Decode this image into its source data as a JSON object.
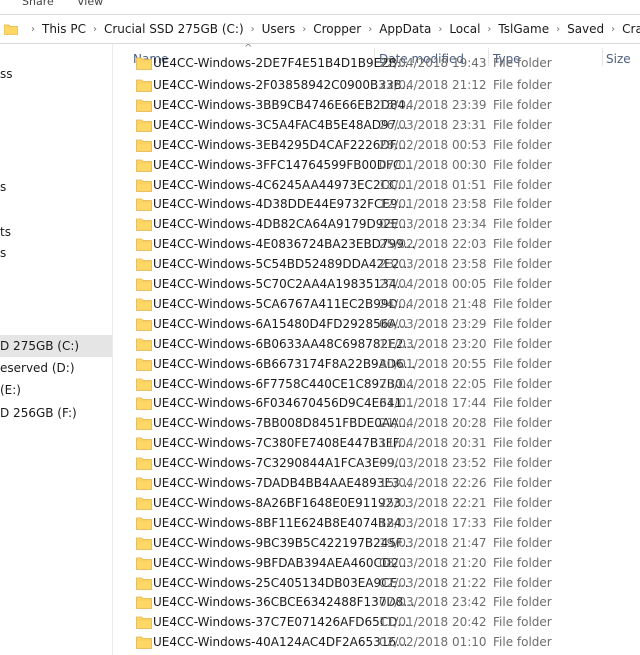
{
  "ribbon": {
    "tabs": [
      "Share",
      "View"
    ]
  },
  "address": {
    "crumbs": [
      "This PC",
      "Crucial SSD 275GB (C:)",
      "Users",
      "Cropper",
      "AppData",
      "Local",
      "TslGame",
      "Saved",
      "Crashes"
    ]
  },
  "nav": {
    "items": [
      {
        "label": "ss",
        "state": ""
      },
      {
        "label": "s",
        "state": ""
      },
      {
        "label": "ts",
        "state": ""
      },
      {
        "label": "s",
        "state": ""
      },
      {
        "label": "D 275GB (C:)",
        "state": "selected"
      },
      {
        "label": "eserved (D:)",
        "state": ""
      },
      {
        "label": "(E:)",
        "state": ""
      },
      {
        "label": "D 256GB (F:)",
        "state": ""
      }
    ]
  },
  "columns": {
    "name": "Name",
    "date": "Date modified",
    "type": "Type",
    "size": "Size"
  },
  "files": [
    {
      "name": "UE4CC-Windows-2F03858942C0900B33B...",
      "date": "22/04/2018 21:12",
      "type": "File folder"
    },
    {
      "name": "UE4CC-Windows-3BB9CB4746E66EB2D84...",
      "date": "15/04/2018 23:39",
      "type": "File folder"
    },
    {
      "name": "UE4CC-Windows-3C5A4FAC4B5E48AD97...",
      "date": "26/03/2018 23:31",
      "type": "File folder"
    },
    {
      "name": "UE4CC-Windows-3EB4295D4CAF2226DF...",
      "date": "28/02/2018 00:53",
      "type": "File folder"
    },
    {
      "name": "UE4CC-Windows-3FFC14764599FB00DFC...",
      "date": "07/01/2018 00:30",
      "type": "File folder"
    },
    {
      "name": "UE4CC-Windows-4C6245AA44973EC2CC...",
      "date": "18/01/2018 01:51",
      "type": "File folder"
    },
    {
      "name": "UE4CC-Windows-4D38DDE44E9732FCE9...",
      "date": "12/01/2018 23:58",
      "type": "File folder"
    },
    {
      "name": "UE4CC-Windows-4DB82CA64A9179D92E...",
      "date": "03/03/2018 23:34",
      "type": "File folder"
    },
    {
      "name": "UE4CC-Windows-4E0836724BA23EBD799...",
      "date": "25/02/2018 22:03",
      "type": "File folder"
    },
    {
      "name": "UE4CC-Windows-5C54BD52489DDA42E2...",
      "date": "23/03/2018 23:58",
      "type": "File folder"
    },
    {
      "name": "UE4CC-Windows-5C70C2AA4A19835134...",
      "date": "27/04/2018 00:05",
      "type": "File folder"
    },
    {
      "name": "UE4CC-Windows-5CA6767A411EC2B99D...",
      "date": "24/04/2018 21:48",
      "type": "File folder"
    },
    {
      "name": "UE4CC-Windows-6A15480D4FD292856A...",
      "date": "06/03/2018 23:29",
      "type": "File folder"
    },
    {
      "name": "UE4CC-Windows-6B0633AA48C698782E2...",
      "date": "11/03/2018 23:20",
      "type": "File folder"
    },
    {
      "name": "UE4CC-Windows-6B6673174F8A22B9AD6...",
      "date": "30/01/2018 20:55",
      "type": "File folder"
    },
    {
      "name": "UE4CC-Windows-6F7758C440CE1C897B0...",
      "date": "23/04/2018 22:05",
      "type": "File folder"
    },
    {
      "name": "UE4CC-Windows-6F034670456D9C4E641...",
      "date": "31/01/2018 17:44",
      "type": "File folder"
    },
    {
      "name": "UE4CC-Windows-7BB008D8451FBDE0AA...",
      "date": "21/04/2018 20:28",
      "type": "File folder"
    },
    {
      "name": "UE4CC-Windows-7C380FE7408E447B3FF...",
      "date": "11/04/2018 20:31",
      "type": "File folder"
    },
    {
      "name": "UE4CC-Windows-7C3290844A1FCA3E99...",
      "date": "09/03/2018 23:52",
      "type": "File folder"
    },
    {
      "name": "UE4CC-Windows-7DADB4BB4AAE4893E3...",
      "date": "15/04/2018 22:26",
      "type": "File folder"
    },
    {
      "name": "UE4CC-Windows-8A26BF1648E0E911923...",
      "date": "25/03/2018 22:21",
      "type": "File folder"
    },
    {
      "name": "UE4CC-Windows-8BF11E624B8E4074B24...",
      "date": "18/03/2018 17:33",
      "type": "File folder"
    },
    {
      "name": "UE4CC-Windows-9BC39B5C422197B245F...",
      "date": "19/03/2018 21:47",
      "type": "File folder"
    },
    {
      "name": "UE4CC-Windows-9BFDAB394AEA460CD2...",
      "date": "08/03/2018 21:20",
      "type": "File folder"
    },
    {
      "name": "UE4CC-Windows-25C405134DB03EA9CE...",
      "date": "02/03/2018 21:22",
      "type": "File folder"
    },
    {
      "name": "UE4CC-Windows-36CBCE6342488F137D8...",
      "date": "07/03/2018 23:42",
      "type": "File folder"
    },
    {
      "name": "UE4CC-Windows-37C7E071426AFD65CD...",
      "date": "11/01/2018 20:42",
      "type": "File folder"
    },
    {
      "name": "UE4CC-Windows-40A124AC4DF2A65316...",
      "date": "02/02/2018 01:10",
      "type": "File folder"
    }
  ],
  "partial_row": {
    "name": "UE4CC-Windows-2DE7F4E51B4D1B9E2B...",
    "date": "22/04/2018 19:43",
    "type": "File folder"
  },
  "colors": {
    "folder": "#ffd766",
    "folder_dark": "#e8b84a",
    "selected": "#cce8ff",
    "header_text": "#4d6080"
  },
  "icons": {
    "folder": "folder-icon",
    "chevron": "chevron-right-icon",
    "sort": "sort-up-icon"
  }
}
